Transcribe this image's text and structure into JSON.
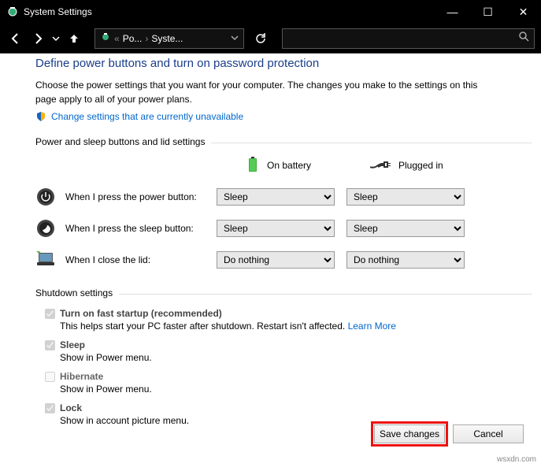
{
  "window": {
    "title": "System Settings",
    "win_min": "—",
    "win_max": "☐",
    "win_close": "✕"
  },
  "nav": {
    "crumb1": "Po...",
    "crumb2": "Syste...",
    "crumb_sep1": "«",
    "crumb_sep2": "›",
    "search_placeholder": ""
  },
  "page": {
    "title": "Define power buttons and turn on password protection",
    "intro": "Choose the power settings that you want for your computer. The changes you make to the settings on this page apply to all of your power plans.",
    "change_link": "Change settings that are currently unavailable"
  },
  "buttons_section": {
    "header": "Power and sleep buttons and lid settings",
    "col_battery": "On battery",
    "col_plugged": "Plugged in",
    "rows": [
      {
        "label": "When I press the power button:",
        "battery": "Sleep",
        "plugged": "Sleep"
      },
      {
        "label": "When I press the sleep button:",
        "battery": "Sleep",
        "plugged": "Sleep"
      },
      {
        "label": "When I close the lid:",
        "battery": "Do nothing",
        "plugged": "Do nothing"
      }
    ]
  },
  "shutdown": {
    "header": "Shutdown settings",
    "items": [
      {
        "label": "Turn on fast startup (recommended)",
        "checked": true,
        "desc": "This helps start your PC faster after shutdown. Restart isn't affected.",
        "link": "Learn More"
      },
      {
        "label": "Sleep",
        "checked": true,
        "desc": "Show in Power menu."
      },
      {
        "label": "Hibernate",
        "checked": false,
        "desc": "Show in Power menu."
      },
      {
        "label": "Lock",
        "checked": true,
        "desc": "Show in account picture menu."
      }
    ]
  },
  "footer": {
    "save": "Save changes",
    "cancel": "Cancel"
  },
  "watermark": "wsxdn.com"
}
